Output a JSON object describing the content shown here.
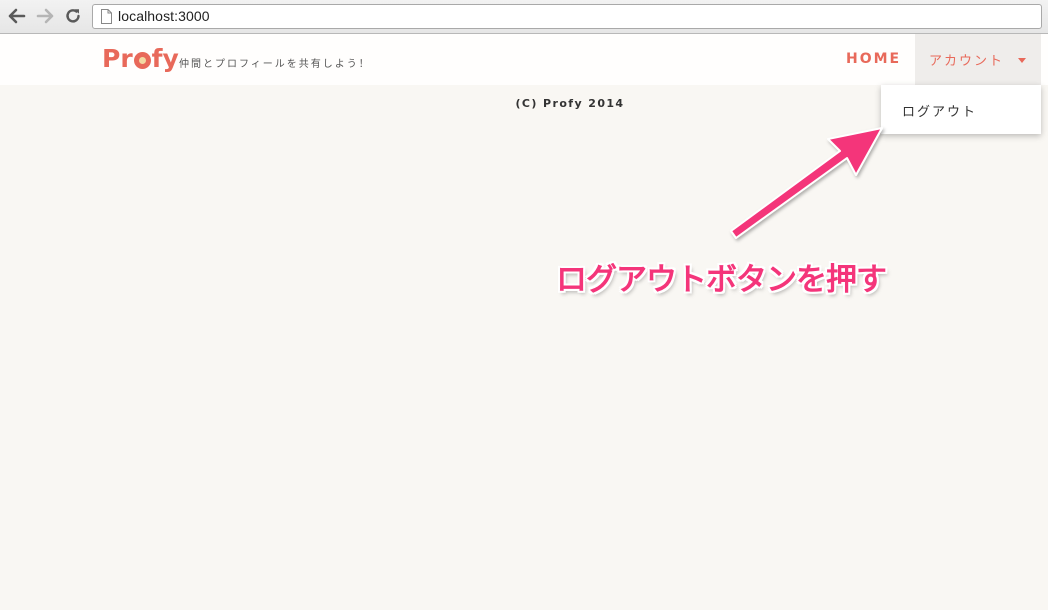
{
  "browser": {
    "url": "localhost:3000",
    "back_icon": "arrow-left-icon",
    "forward_icon": "arrow-right-icon",
    "reload_icon": "reload-icon",
    "page_icon": "document-icon"
  },
  "header": {
    "logo_prefix": "Pr",
    "logo_suffix": "fy",
    "tagline": "仲間とプロフィールを共有しよう！",
    "home_label": "HOME",
    "account_label": "アカウント"
  },
  "dropdown": {
    "logout_label": "ログアウト"
  },
  "footer": {
    "copyright": "(C) Profy 2014"
  },
  "annotation": {
    "text": "ログアウトボタンを押す"
  },
  "colors": {
    "brand": "#e8695a",
    "annotation": "#f4357a",
    "background": "#f9f7f3"
  }
}
